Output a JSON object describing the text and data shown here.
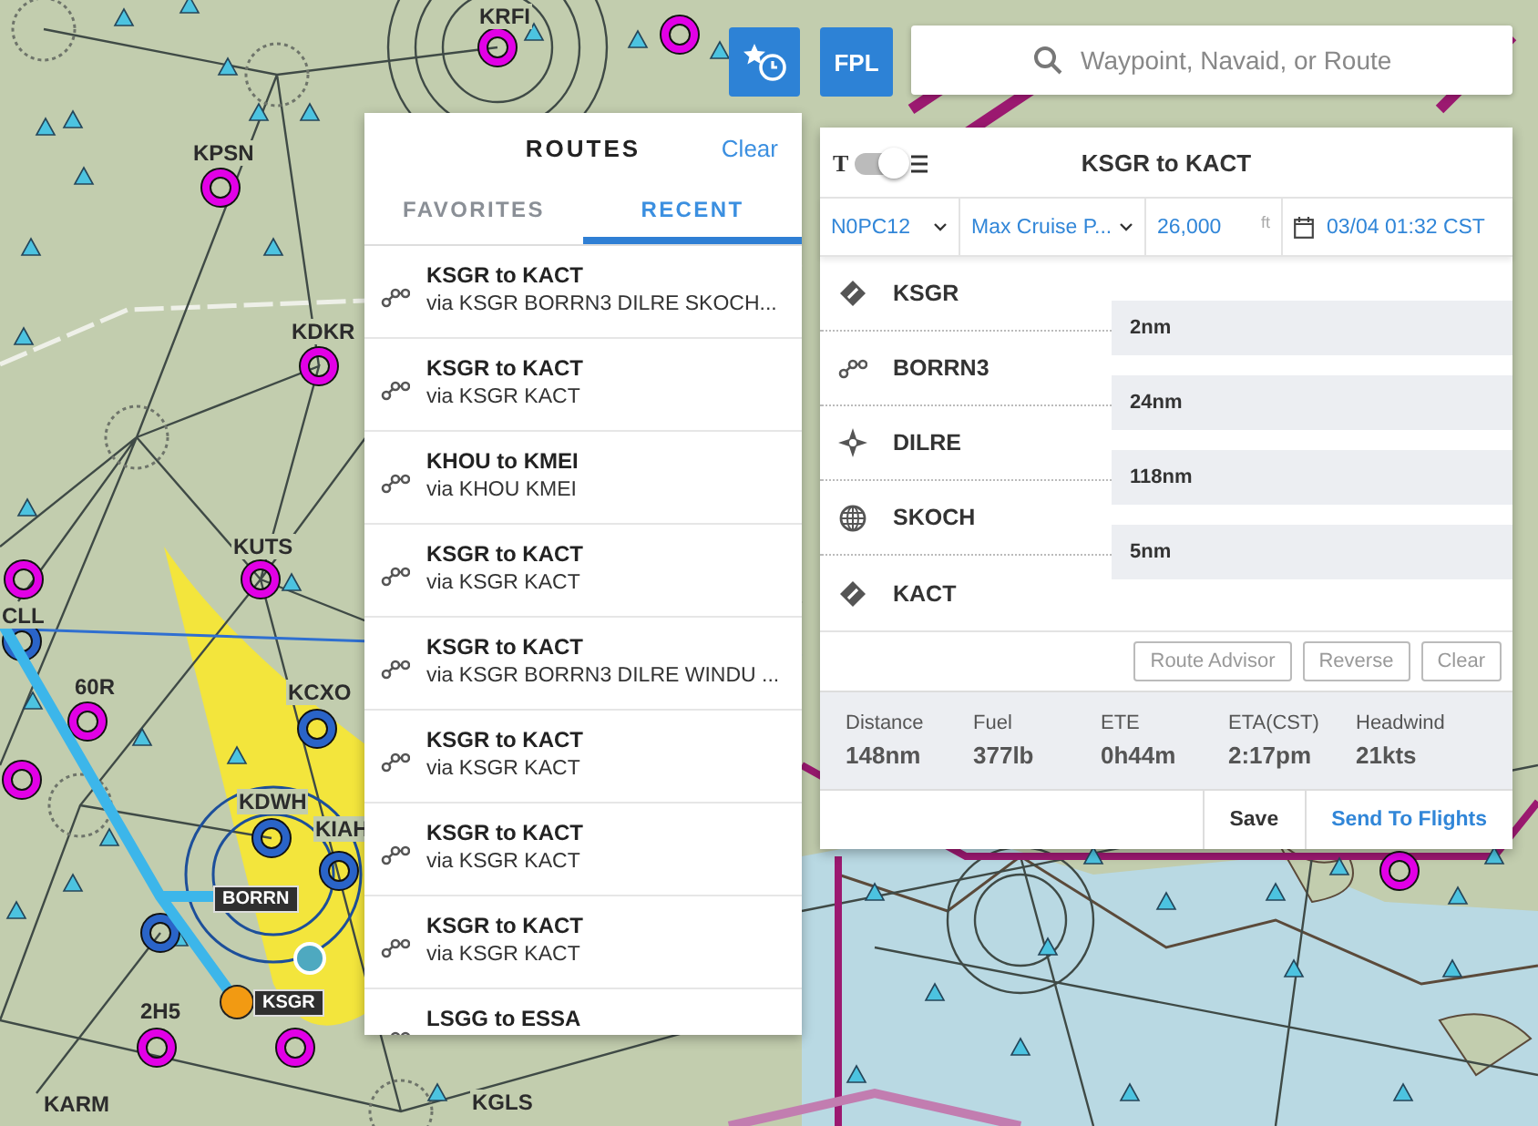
{
  "map": {
    "labels": [
      {
        "text": "KRFI",
        "kind": "airport"
      },
      {
        "text": "KPSN",
        "kind": "airport"
      },
      {
        "text": "KDKR",
        "kind": "airport"
      },
      {
        "text": "KUTS",
        "kind": "airport"
      },
      {
        "text": "CLL",
        "kind": "airport"
      },
      {
        "text": "60R",
        "kind": "airport"
      },
      {
        "text": "KCXO",
        "kind": "airport"
      },
      {
        "text": "KDWH",
        "kind": "airport"
      },
      {
        "text": "KIAH",
        "kind": "airport"
      },
      {
        "text": "BORRN",
        "kind": "tag"
      },
      {
        "text": "KSGR",
        "kind": "tag"
      },
      {
        "text": "2H5",
        "kind": "airport"
      },
      {
        "text": "KARM",
        "kind": "airport"
      },
      {
        "text": "KGLS",
        "kind": "airport"
      }
    ]
  },
  "toolbar": {
    "fpl_button": "FPL",
    "search": {
      "placeholder": "Waypoint, Navaid, or Route"
    }
  },
  "routes_panel": {
    "title": "ROUTES",
    "clear": "Clear",
    "tabs": [
      {
        "label": "FAVORITES",
        "selected": false
      },
      {
        "label": "RECENT",
        "selected": true
      }
    ],
    "items": [
      {
        "title": "KSGR to KACT",
        "via": "via KSGR BORRN3 DILRE SKOCH..."
      },
      {
        "title": "KSGR to KACT",
        "via": "via KSGR KACT"
      },
      {
        "title": "KHOU to KMEI",
        "via": "via KHOU KMEI"
      },
      {
        "title": "KSGR to KACT",
        "via": "via KSGR KACT"
      },
      {
        "title": "KSGR to KACT",
        "via": "via KSGR BORRN3 DILRE WINDU ..."
      },
      {
        "title": "KSGR to KACT",
        "via": "via KSGR KACT"
      },
      {
        "title": "KSGR to KACT",
        "via": "via KSGR KACT"
      },
      {
        "title": "KSGR to KACT",
        "via": "via KSGR KACT"
      },
      {
        "title": "LSGG to ESSA"
      }
    ]
  },
  "flight_plan": {
    "title": "KSGR to KACT",
    "text_mode": {
      "letter": "T",
      "on": true
    },
    "aircraft": "N0PC12",
    "profile": "Max Cruise P...",
    "altitude": "26,000",
    "altitude_unit": "ft",
    "departure": "03/04 01:32 CST",
    "waypoints": [
      {
        "name": "KSGR",
        "kind": "airport"
      },
      {
        "name": "BORRN3",
        "kind": "procedure"
      },
      {
        "name": "DILRE",
        "kind": "intersection"
      },
      {
        "name": "SKOCH",
        "kind": "gps"
      },
      {
        "name": "KACT",
        "kind": "airport"
      }
    ],
    "legs": [
      "2nm",
      "24nm",
      "118nm",
      "5nm"
    ],
    "buttons": [
      "Route Advisor",
      "Reverse",
      "Clear"
    ],
    "stats": [
      {
        "label": "Distance",
        "value": "148nm"
      },
      {
        "label": "Fuel",
        "value": "377lb"
      },
      {
        "label": "ETE",
        "value": "0h44m"
      },
      {
        "label": "ETA(CST)",
        "value": "2:17pm"
      },
      {
        "label": "Headwind",
        "value": "21kts"
      }
    ],
    "save": "Save",
    "send": "Send To Flights"
  }
}
